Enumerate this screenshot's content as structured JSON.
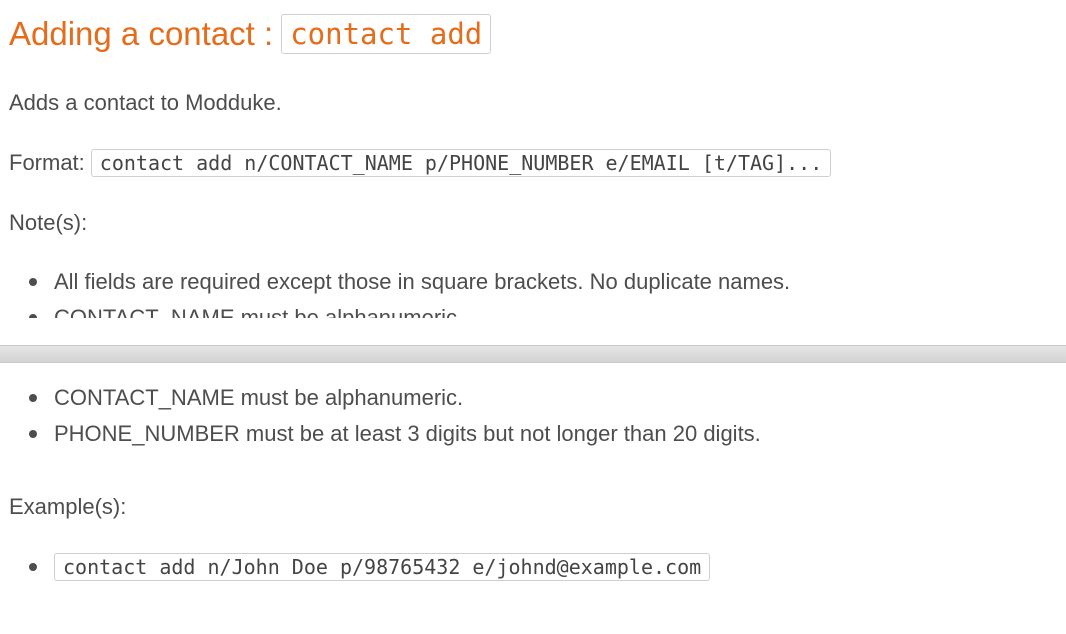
{
  "heading": {
    "text": "Adding a contact : ",
    "command": "contact add"
  },
  "description": "Adds a contact to Modduke.",
  "format": {
    "label": "Format:",
    "code": "contact add n/CONTACT_NAME p/PHONE_NUMBER e/EMAIL [t/TAG]..."
  },
  "notes_label": "Note(s):",
  "notes": [
    "All fields are required except those in square brackets. No duplicate names.",
    "CONTACT_NAME must be alphanumeric.",
    "PHONE_NUMBER must be at least 3 digits but not longer than 20 digits."
  ],
  "examples_label": "Example(s):",
  "examples": [
    "contact add n/John Doe p/98765432 e/johnd@example.com"
  ]
}
